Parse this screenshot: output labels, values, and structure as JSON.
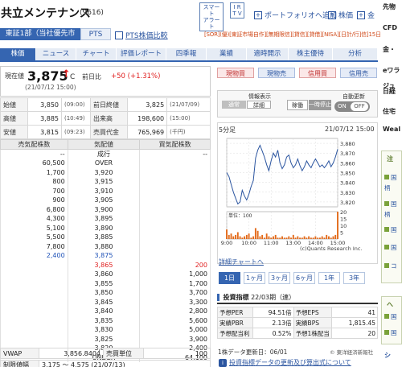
{
  "header": {
    "company_name": "共立メンテナンス",
    "stock_code": "(9616)",
    "smart_alert_1": "スマート",
    "smart_alert_2": "アラート",
    "ir_tv_1": "I R",
    "ir_tv_2": "T V",
    "portfolio_add": "ポートフォリオへ追加",
    "stock_info": "株価",
    "finance": "金",
    "sidebar_top": "先物"
  },
  "market": {
    "exchange_tab": "東証1部（当社優先市場）",
    "pts_tab": "PTS",
    "pts_compare": "PTS株価比較",
    "badges": "[SOR](優)[東証市場自作][無期限信][貸信][貸借][NISA][日計/行]信]15日高]"
  },
  "nav": {
    "tabs": [
      "株価",
      "ニュース",
      "チャート",
      "評価レポート",
      "四季報",
      "業績",
      "適時開示",
      "株主優待",
      "分析"
    ]
  },
  "price": {
    "now_label": "現在値",
    "now_value": "3,875",
    "arrow": "↑",
    "c_mark": "C",
    "prev_label": "前日比",
    "change": "+50 (+1.31%)",
    "timestamp": "(21/07/12 15:00)"
  },
  "quote": {
    "rows": [
      {
        "l1": "始値",
        "v1": "3,850",
        "t1": "(09:00)",
        "l2": "前日終値",
        "v2": "3,825",
        "t2": "(21/07/09)"
      },
      {
        "l1": "高値",
        "v1": "3,885",
        "t1": "(10:49)",
        "l2": "出来高",
        "v2": "198,600",
        "t2": "(15:00)"
      },
      {
        "l1": "安値",
        "v1": "3,815",
        "t1": "(09:23)",
        "l2": "売買代金",
        "v2": "765,969",
        "t2": "(千円)"
      }
    ]
  },
  "orderbook": {
    "headers": [
      "売気配株数",
      "気配値",
      "買気配株数"
    ],
    "rows": [
      {
        "sell": "--",
        "price": "成行",
        "buy": "--",
        "cls": ""
      },
      {
        "sell": "60,500",
        "price": "OVER",
        "buy": "",
        "cls": ""
      },
      {
        "sell": "1,700",
        "price": "3,920",
        "buy": "",
        "cls": ""
      },
      {
        "sell": "800",
        "price": "3,915",
        "buy": "",
        "cls": ""
      },
      {
        "sell": "700",
        "price": "3,910",
        "buy": "",
        "cls": ""
      },
      {
        "sell": "900",
        "price": "3,905",
        "buy": "",
        "cls": ""
      },
      {
        "sell": "6,800",
        "price": "3,900",
        "buy": "",
        "cls": ""
      },
      {
        "sell": "4,300",
        "price": "3,895",
        "buy": "",
        "cls": ""
      },
      {
        "sell": "5,100",
        "price": "3,890",
        "buy": "",
        "cls": ""
      },
      {
        "sell": "5,500",
        "price": "3,885",
        "buy": "",
        "cls": ""
      },
      {
        "sell": "7,800",
        "price": "3,880",
        "buy": "",
        "cls": ""
      },
      {
        "sell": "2,400",
        "price": "3,875",
        "buy": "",
        "cls": "blue"
      },
      {
        "sell": "",
        "price": "3,865",
        "buy": "200",
        "cls": "red"
      },
      {
        "sell": "",
        "price": "3,860",
        "buy": "1,000",
        "cls": ""
      },
      {
        "sell": "",
        "price": "3,855",
        "buy": "1,700",
        "cls": ""
      },
      {
        "sell": "",
        "price": "3,850",
        "buy": "3,700",
        "cls": ""
      },
      {
        "sell": "",
        "price": "3,845",
        "buy": "3,300",
        "cls": ""
      },
      {
        "sell": "",
        "price": "3,840",
        "buy": "2,800",
        "cls": ""
      },
      {
        "sell": "",
        "price": "3,835",
        "buy": "5,600",
        "cls": ""
      },
      {
        "sell": "",
        "price": "3,830",
        "buy": "5,000",
        "cls": ""
      },
      {
        "sell": "",
        "price": "3,825",
        "buy": "3,900",
        "cls": ""
      },
      {
        "sell": "",
        "price": "3,820",
        "buy": "2,400",
        "cls": ""
      },
      {
        "sell": "",
        "price": "UNDER",
        "buy": "64,100",
        "cls": ""
      }
    ]
  },
  "bottom": {
    "vwap_label": "VWAP",
    "vwap_value": "3,856.8404",
    "unit_label": "売買単位",
    "unit_value": "100",
    "limit_label": "制限値幅",
    "limit_value": "3,175 ～ 4,575 (21/07/13)"
  },
  "trade": {
    "cash_buy": "現物買",
    "cash_sell": "現物売",
    "margin_buy": "信用買",
    "margin_sell": "信用売"
  },
  "info_panel": {
    "display_label": "情報表示",
    "normal": "通常",
    "detail": "詳細",
    "running": "稼働",
    "pause": "一時停止",
    "auto_label": "自動更新",
    "on": "ON",
    "off": "OFF"
  },
  "chart": {
    "interval": "5分足",
    "date": "21/07/12 15:00",
    "vol_unit": "単位：100",
    "copyright": "(c)Quants Research Inc.",
    "detail_link": "詳細チャートへ",
    "periods": [
      "1日",
      "1ヶ月",
      "3ヶ月",
      "6ヶ月",
      "1年",
      "3年"
    ]
  },
  "chart_data": {
    "type": "line",
    "title": "",
    "x_ticks": [
      "9:00",
      "10:00",
      "11:00",
      "13:00",
      "14:00",
      "15:00"
    ],
    "y_ticks": [
      3820,
      3830,
      3840,
      3850,
      3860,
      3870,
      3880
    ],
    "ylim": [
      3815,
      3885
    ],
    "prices": [
      3850,
      3846,
      3838,
      3830,
      3824,
      3818,
      3820,
      3832,
      3826,
      3822,
      3828,
      3836,
      3842,
      3865,
      3873,
      3878,
      3872,
      3866,
      3858,
      3852,
      3862,
      3870,
      3866,
      3873,
      3860,
      3854,
      3858,
      3866,
      3868,
      3860,
      3855,
      3858,
      3864,
      3857,
      3852,
      3856,
      3862,
      3858,
      3855,
      3860,
      3864,
      3860,
      3856,
      3858,
      3855,
      3858,
      3862,
      3856,
      3860,
      3866,
      3874
    ],
    "volumes": [
      7,
      3,
      4,
      2,
      3,
      5,
      2,
      1,
      2,
      3,
      4,
      1,
      2,
      8,
      6,
      2,
      3,
      1,
      4,
      2,
      1,
      2,
      3,
      1,
      1,
      2,
      1,
      1,
      2,
      1,
      3,
      1,
      2,
      1,
      1,
      2,
      1,
      2,
      1,
      1,
      2,
      1,
      1,
      2,
      1,
      3,
      2,
      1,
      2,
      3,
      20
    ],
    "vol_ylim": [
      0,
      20
    ],
    "vol_ticks": [
      5,
      10,
      15,
      20
    ]
  },
  "indicators": {
    "heading": "投資指標",
    "period": "22/03期（連）",
    "rows": [
      {
        "l1": "予想PER",
        "v1": "94.51倍",
        "l2": "予想EPS",
        "v2": "41"
      },
      {
        "l1": "実績PBR",
        "v1": "2.13倍",
        "l2": "実績BPS",
        "v2": "1,815.45"
      },
      {
        "l1": "予想配当利",
        "v1": "0.52%",
        "l2": "予想1株配当",
        "v2": "20"
      }
    ],
    "updated": "1株データ更新日：06/01",
    "source": "© 東洋経済新報社",
    "link": "投資指標データの更新及び算出式について"
  },
  "sidebar": {
    "items": [
      "CFD",
      "金・",
      "eワラ",
      "日経",
      "ジュ",
      "住宅",
      "Weal"
    ],
    "card_title": "注",
    "links": [
      "国",
      "柄",
      "国",
      "柄",
      "国",
      "国",
      "コ"
    ],
    "card2": "へ",
    "links2": [
      "国",
      "国"
    ],
    "bottom": "シ"
  }
}
